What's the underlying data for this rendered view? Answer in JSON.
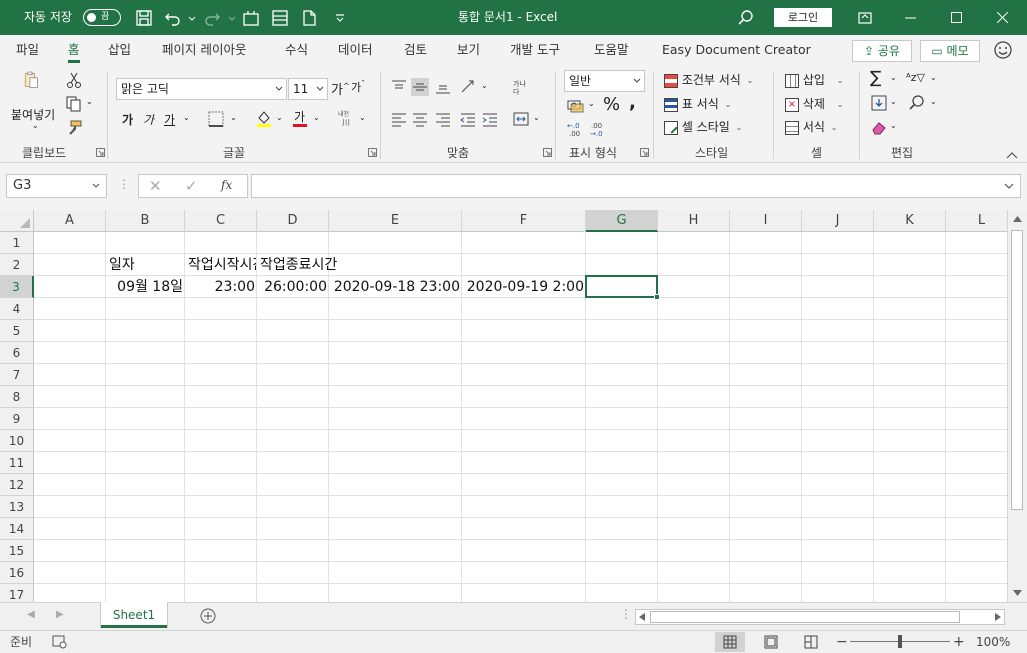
{
  "titlebar": {
    "autosave_label": "자동 저장",
    "autosave_state": "끔",
    "doc_title": "통합 문서1  -  Excel",
    "login_label": "로그인"
  },
  "tabs": [
    {
      "label": "파일",
      "active": false
    },
    {
      "label": "홈",
      "active": true
    },
    {
      "label": "삽입",
      "active": false
    },
    {
      "label": "페이지 레이아웃",
      "active": false
    },
    {
      "label": "수식",
      "active": false
    },
    {
      "label": "데이터",
      "active": false
    },
    {
      "label": "검토",
      "active": false
    },
    {
      "label": "보기",
      "active": false
    },
    {
      "label": "개발 도구",
      "active": false
    },
    {
      "label": "도움말",
      "active": false
    },
    {
      "label": "Easy Document Creator",
      "active": false
    }
  ],
  "share_label": "공유",
  "memo_label": "메모",
  "ribbon": {
    "clipboard": {
      "paste_label": "붙여넣기",
      "group_label": "클립보드"
    },
    "font": {
      "font_name": "맑은 고딕",
      "font_size": "11",
      "bold": "가",
      "italic": "가",
      "underline": "가",
      "group_label": "글꼴"
    },
    "align": {
      "group_label": "맞춤"
    },
    "number": {
      "format": "일반",
      "group_label": "표시 형식"
    },
    "styles": {
      "conditional": "조건부 서식",
      "table": "표 서식",
      "cell": "셀 스타일",
      "group_label": "스타일"
    },
    "cells": {
      "insert": "삽입",
      "delete": "삭제",
      "format": "서식",
      "group_label": "셀"
    },
    "editing": {
      "group_label": "편집"
    }
  },
  "formula_bar": {
    "name_box": "G3",
    "formula": ""
  },
  "sheet": {
    "columns": [
      "A",
      "B",
      "C",
      "D",
      "E",
      "F",
      "G",
      "H",
      "I",
      "J",
      "K",
      "L"
    ],
    "selected_column": "G",
    "rows": [
      "1",
      "2",
      "3",
      "4",
      "5",
      "6",
      "7",
      "8",
      "9",
      "10",
      "11",
      "12",
      "13",
      "14",
      "15",
      "16",
      "17"
    ],
    "selected_row": "3",
    "cells": {
      "B2": "일자",
      "C2": "작업시작시간",
      "D2": "작업종료시간",
      "B3": "09월 18일",
      "C3": "23:00",
      "D3": "26:00:00",
      "E3": "2020-09-18 23:00",
      "F3": "2020-09-19 2:00"
    }
  },
  "sheet_tabs": [
    "Sheet1"
  ],
  "status": {
    "ready": "준비",
    "zoom": "100%"
  },
  "colors": {
    "accent": "#217346"
  }
}
